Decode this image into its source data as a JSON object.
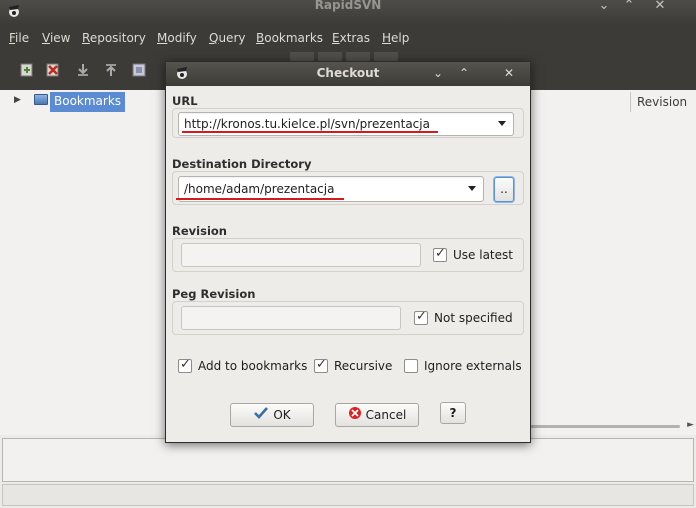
{
  "main_window": {
    "title": "RapidSVN",
    "menu": [
      "File",
      "View",
      "Repository",
      "Modify",
      "Query",
      "Bookmarks",
      "Extras",
      "Help"
    ],
    "tree": {
      "root_label": "Bookmarks"
    },
    "columns": {
      "revision": "Revision"
    }
  },
  "dialog": {
    "title": "Checkout",
    "url_label": "URL",
    "url_value": "http://kronos.tu.kielce.pl/svn/prezentacja",
    "dest_label": "Destination Directory",
    "dest_value": "/home/adam/prezentacja",
    "browse_label": "..",
    "revision_label": "Revision",
    "revision_value": "",
    "use_latest_label": "Use latest",
    "use_latest_checked": true,
    "peg_revision_label": "Peg Revision",
    "peg_revision_value": "",
    "not_specified_label": "Not specified",
    "not_specified_checked": true,
    "add_bookmarks_label": "Add to bookmarks",
    "add_bookmarks_checked": true,
    "recursive_label": "Recursive",
    "recursive_checked": true,
    "ignore_externals_label": "Ignore externals",
    "ignore_externals_checked": false,
    "ok_label": "OK",
    "cancel_label": "Cancel",
    "help_label": "?"
  },
  "colors": {
    "titlebar": "#3c3b37",
    "highlight_underline": "#d41a1a",
    "selection": "#5b8bd2"
  }
}
